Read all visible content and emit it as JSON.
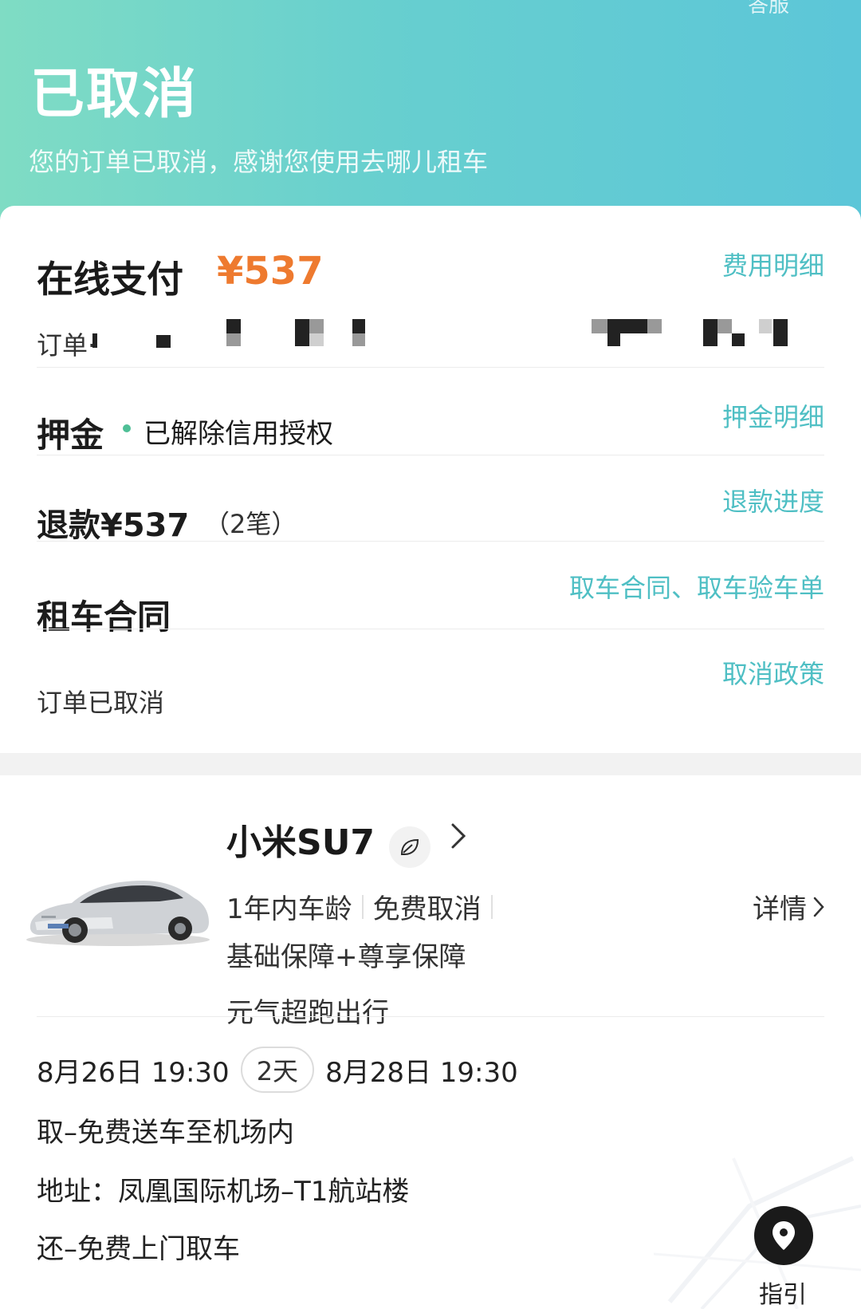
{
  "header": {
    "corner_text": "答服",
    "status_title": "已取消",
    "status_subtitle": "您的订单已取消，感谢您使用去哪儿租车"
  },
  "payment": {
    "label": "在线支付",
    "amount": "¥537",
    "detail_link": "费用明细",
    "order_label": "订单·"
  },
  "deposit": {
    "label": "押金",
    "status": "已解除信用授权",
    "detail_link": "押金明细"
  },
  "refund": {
    "label": "退款¥537",
    "count": "（2笔）",
    "progress_link": "退款进度"
  },
  "contract": {
    "label": "租车合同",
    "links": "取车合同、取车验车单"
  },
  "cancellation": {
    "label": "订单已取消",
    "policy_link": "取消政策"
  },
  "car": {
    "name": "小米SU7",
    "tags": [
      "1年内车龄",
      "免费取消"
    ],
    "details_link": "详情",
    "protection": "基础保障+尊享保障",
    "slogan": "元气超跑出行",
    "icon": "leaf-icon"
  },
  "rental": {
    "pickup_time": "8月26日 19:30",
    "duration": "2天",
    "return_time": "8月28日 19:30",
    "pickup_method": "取–免费送车至机场内",
    "address": "地址：凤凰国际机场–T1航站楼",
    "return_method": "还–免费上门取车",
    "guide_label": "指引"
  },
  "colors": {
    "header_gradient_start": "#7fdcc4",
    "header_gradient_end": "#5cc6d8",
    "accent_link": "#4fbfc4",
    "price_orange": "#ee7a2f",
    "status_dot": "#4fbf96"
  }
}
